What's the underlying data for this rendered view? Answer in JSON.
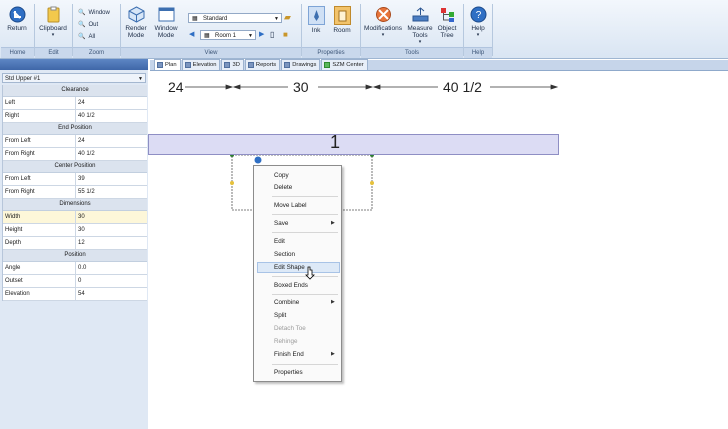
{
  "ribbon": {
    "buttons": {
      "return": "Return",
      "clipboard": "Clipboard",
      "window": "Window",
      "out": "Out",
      "all": "All",
      "render_mode": "Render Mode",
      "window_mode": "Window Mode",
      "ink": "Ink",
      "room": "Room",
      "modifications": "Modifications",
      "measure_tools": "Measure Tools",
      "object_tree": "Object Tree",
      "help": "Help"
    },
    "combos": {
      "style": "Standard",
      "room": "Room 1"
    },
    "groups": {
      "home": "Home",
      "edit": "Edit",
      "zoom": "Zoom",
      "view": "View",
      "properties": "Properties",
      "tools": "Tools",
      "help": "Help"
    }
  },
  "panel": {
    "selected": "Std Upper #1",
    "sections": [
      {
        "header": "Clearance",
        "rows": [
          {
            "k": "Left",
            "v": "24"
          },
          {
            "k": "Right",
            "v": "40 1/2"
          }
        ]
      },
      {
        "header": "End Position",
        "rows": [
          {
            "k": "From Left",
            "v": "24"
          },
          {
            "k": "From Right",
            "v": "40 1/2"
          }
        ]
      },
      {
        "header": "Center Position",
        "rows": [
          {
            "k": "From Left",
            "v": "39"
          },
          {
            "k": "From Right",
            "v": "55 1/2"
          }
        ]
      },
      {
        "header": "Dimensions",
        "rows": [
          {
            "k": "Width",
            "v": "30"
          },
          {
            "k": "Height",
            "v": "30"
          },
          {
            "k": "Depth",
            "v": "12"
          }
        ]
      },
      {
        "header": "Position",
        "rows": [
          {
            "k": "Angle",
            "v": "0.0"
          },
          {
            "k": "Outset",
            "v": "0"
          },
          {
            "k": "Elevation",
            "v": "54"
          }
        ]
      }
    ]
  },
  "tabs": [
    "Plan",
    "Elevation",
    "3D",
    "Reports",
    "Drawings",
    "SZM Center"
  ],
  "dimensions": {
    "d1": "24",
    "d2": "30",
    "d3": "40 1/2"
  },
  "cabinet_label": "1",
  "context_menu": {
    "copy": "Copy",
    "delete": "Delete",
    "move_label": "Move Label",
    "save": "Save",
    "edit": "Edit",
    "section": "Section",
    "edit_shape": "Edit Shape",
    "boxed_ends": "Boxed Ends",
    "combine": "Combine",
    "split": "Split",
    "detach_toe": "Detach Toe",
    "rehinge": "Rehinge",
    "finish_end": "Finish End",
    "properties": "Properties"
  },
  "colors": {
    "ribbon": "#d9e5f3",
    "panel_title": "#3f67a8",
    "cabinet": "#dcdcf4",
    "menu_highlight": "#dde9f7"
  }
}
